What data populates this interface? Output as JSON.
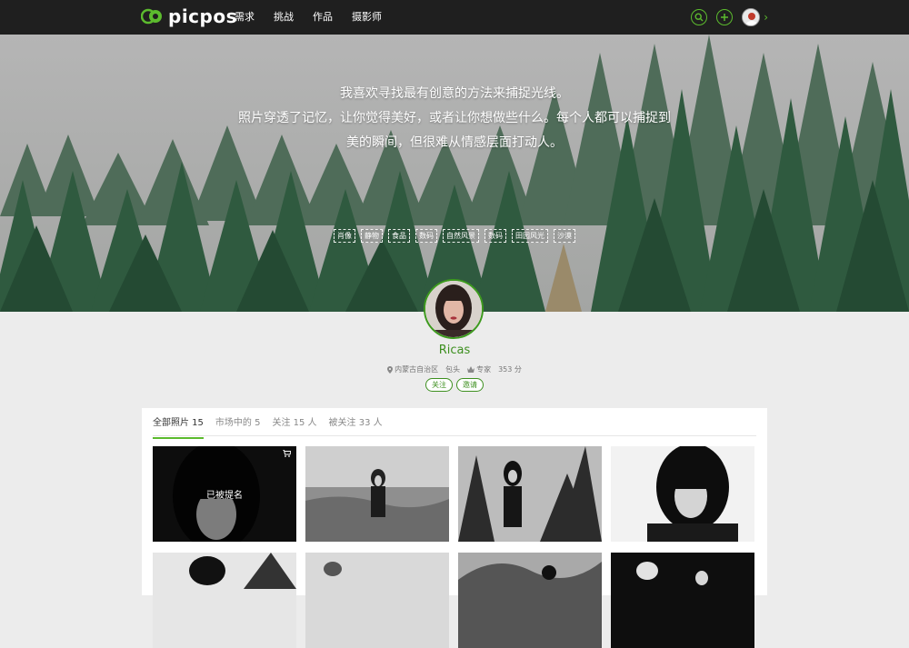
{
  "brand": {
    "name": "picpos",
    "color": "#5cbb2e"
  },
  "nav": {
    "items": [
      "需求",
      "挑战",
      "作品",
      "摄影师"
    ]
  },
  "tools": {
    "search_icon": "search-icon",
    "add_icon": "plus-icon",
    "chevron": "›"
  },
  "hero": {
    "quote_lines": [
      "我喜欢寻找最有创意的方法来捕捉光线。",
      "照片穿透了记忆，让你觉得美好，或者让你想做些什么。每个人都可以捕捉到",
      "美的瞬间，但很难从情感层面打动人。"
    ],
    "tags": [
      "肖像",
      "静物",
      "食品",
      "数码",
      "自然风景",
      "数码",
      "田园风光",
      "沙漠"
    ]
  },
  "profile": {
    "name": "Ricas",
    "location": "内蒙古自治区",
    "city": "包头",
    "level": "专家",
    "score": "353 分",
    "follow_label": "关注",
    "invite_label": "邀请"
  },
  "tabs": [
    {
      "label": "全部照片 15",
      "active": true
    },
    {
      "label": "市场中的 5",
      "active": false
    },
    {
      "label": "关注 15 人",
      "active": false
    },
    {
      "label": "被关注 33 人",
      "active": false
    }
  ],
  "photos": [
    {
      "overlay": "已被提名",
      "cart": true
    },
    {
      "overlay": "",
      "cart": false
    },
    {
      "overlay": "",
      "cart": false
    },
    {
      "overlay": "",
      "cart": false
    },
    {
      "overlay": "",
      "cart": false
    },
    {
      "overlay": "",
      "cart": false
    },
    {
      "overlay": "",
      "cart": false
    },
    {
      "overlay": "",
      "cart": false
    }
  ]
}
